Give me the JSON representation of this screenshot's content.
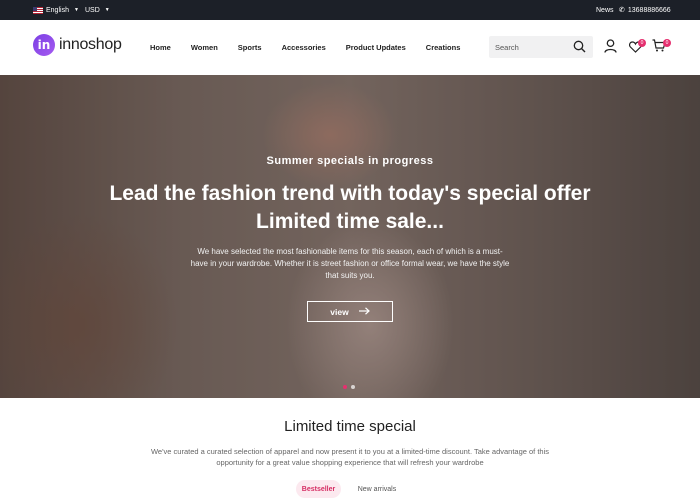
{
  "topbar": {
    "language": "English",
    "currency": "USD",
    "news": "News",
    "phone": "13688886666"
  },
  "header": {
    "logo_text": "innoshop",
    "logo_mark": "in",
    "nav": [
      "Home",
      "Women",
      "Sports",
      "Accessories",
      "Product Updates",
      "Creations"
    ],
    "search_placeholder": "Search",
    "wishlist_count": "0",
    "cart_count": "0",
    "icons": [
      "search-icon",
      "user-icon",
      "heart-icon",
      "cart-icon",
      "phone-icon",
      "flag-icon"
    ]
  },
  "hero": {
    "subtitle": "Summer specials in progress",
    "title_line1": "Lead the fashion trend with today's special offer",
    "title_line2": "Limited time sale...",
    "description": "We have selected the most fashionable items for this season, each of which is a must-have in your wardrobe. Whether it is street fashion or office formal wear, we have the style that suits you.",
    "button_label": "view",
    "slides_count": 2,
    "active_slide": 1
  },
  "section": {
    "title": "Limited time special",
    "description": "We've curated a curated selection of apparel and now present it to you at a limited-time discount. Take advantage of this opportunity for a great value shopping experience that will refresh your wardrobe",
    "tabs": [
      "Bestseller",
      "New arrivals"
    ]
  },
  "colors": {
    "topbar_bg": "#1c2028",
    "accent": "#e5306f",
    "logo": "#7b3fe4"
  }
}
